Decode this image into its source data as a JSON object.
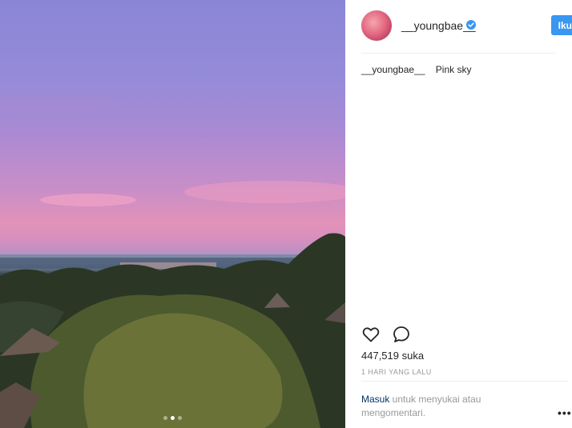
{
  "post": {
    "photo_description": "",
    "carousel": {
      "count": 3,
      "active_index": 1
    }
  },
  "header": {
    "username": "__youngbae__",
    "verified_icon": "verified-badge-icon",
    "follow_label": "Ikuti"
  },
  "caption": {
    "username": "__youngbae__",
    "text": "Pink sky"
  },
  "actions": {
    "like_icon": "heart-icon",
    "comment_icon": "comment-icon"
  },
  "likes": {
    "count_text": "447,519 suka"
  },
  "timestamp": {
    "text": "1 HARI YANG LALU"
  },
  "login_prompt": {
    "link_text": "Masuk",
    "rest_text": " untuk menyukai atau mengomentari."
  },
  "more_options": {
    "label": "•••"
  },
  "colors": {
    "accent": "#3897f0",
    "link": "#003569",
    "muted": "#999999"
  }
}
